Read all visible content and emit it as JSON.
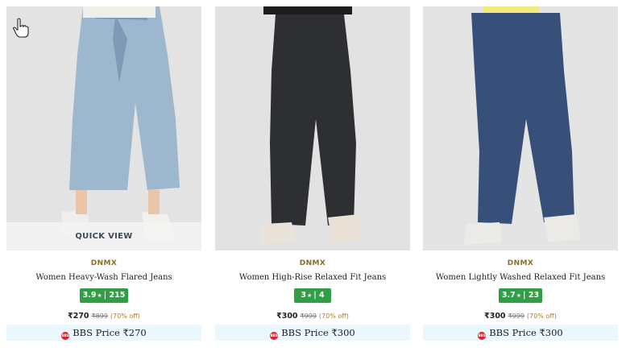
{
  "colors": {
    "rating_bg": "#2f9e44",
    "brand": "#8a6d2c",
    "bbs_bg": "#eaf7fc",
    "bbs_logo": "#d9232d"
  },
  "products": [
    {
      "brand": "DNMX",
      "name": "Women Heavy-Wash Flared Jeans",
      "rating": "3.9",
      "reviews": "215",
      "price": "₹270",
      "mrp": "₹899",
      "discount": "(70% off)",
      "bbs_label": "BBS Price ₹270",
      "quick_view": "QUICK VIEW",
      "jeans_color": "#9db7cf"
    },
    {
      "brand": "DNMX",
      "name": "Women High-Rise Relaxed Fit Jeans",
      "rating": "3",
      "reviews": "4",
      "price": "₹300",
      "mrp": "₹999",
      "discount": "(70% off)",
      "bbs_label": "BBS Price ₹300",
      "jeans_color": "#2e2f33"
    },
    {
      "brand": "DNMX",
      "name": "Women Lightly Washed Relaxed Fit Jeans",
      "rating": "3.7",
      "reviews": "23",
      "price": "₹300",
      "mrp": "₹999",
      "discount": "(70% off)",
      "bbs_label": "BBS Price ₹300",
      "jeans_color": "#37507a"
    }
  ]
}
